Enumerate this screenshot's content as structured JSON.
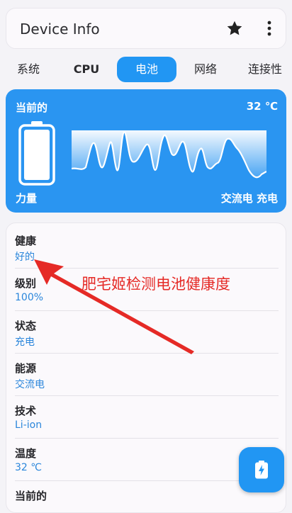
{
  "app": {
    "title": "Device Info"
  },
  "tabs": [
    {
      "label": "系统"
    },
    {
      "label": "CPU"
    },
    {
      "label": "电池"
    },
    {
      "label": "网络"
    },
    {
      "label": "连接性"
    }
  ],
  "active_tab": "电池",
  "hero": {
    "top_left": "当前的",
    "temperature": "32 ℃",
    "bottom_left": "力量",
    "bottom_right": "交流电 充电",
    "battery_level": 1.0
  },
  "details": [
    {
      "key": "健康",
      "value": "好的"
    },
    {
      "key": "级别",
      "value": "100%"
    },
    {
      "key": "状态",
      "value": "充电"
    },
    {
      "key": "能源",
      "value": "交流电"
    },
    {
      "key": "技术",
      "value": "Li-ion"
    },
    {
      "key": "温度",
      "value": "32 ℃"
    },
    {
      "key": "当前的",
      "value": ""
    }
  ],
  "annotation": {
    "text": "肥宅姬检测电池健康度"
  },
  "icons": {
    "favorite": "star-icon",
    "menu": "more-vert-icon",
    "fab": "battery-charging-icon"
  },
  "colors": {
    "accent": "#2196f3",
    "annotation": "#e52a26"
  }
}
